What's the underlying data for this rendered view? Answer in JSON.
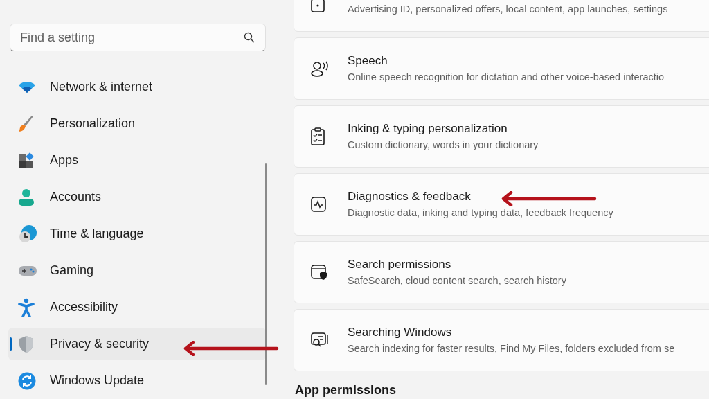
{
  "sidebar": {
    "search": {
      "placeholder": "Find a setting"
    },
    "items": [
      {
        "label": "Network & internet",
        "selected": false
      },
      {
        "label": "Personalization",
        "selected": false
      },
      {
        "label": "Apps",
        "selected": false
      },
      {
        "label": "Accounts",
        "selected": false
      },
      {
        "label": "Time & language",
        "selected": false
      },
      {
        "label": "Gaming",
        "selected": false
      },
      {
        "label": "Accessibility",
        "selected": false
      },
      {
        "label": "Privacy & security",
        "selected": true
      },
      {
        "label": "Windows Update",
        "selected": false
      }
    ]
  },
  "main": {
    "cards": [
      {
        "description": "Advertising ID, personalized offers, local content, app launches, settings"
      },
      {
        "title": "Speech",
        "description": "Online speech recognition for dictation and other voice-based interactio"
      },
      {
        "title": "Inking & typing personalization",
        "description": "Custom dictionary, words in your dictionary"
      },
      {
        "title": "Diagnostics & feedback",
        "description": "Diagnostic data, inking and typing data, feedback frequency"
      },
      {
        "title": "Search permissions",
        "description": "SafeSearch, cloud content search, search history"
      },
      {
        "title": "Searching Windows",
        "description": "Search indexing for faster results, Find My Files, folders excluded from se"
      }
    ],
    "section_heading": "App permissions"
  }
}
